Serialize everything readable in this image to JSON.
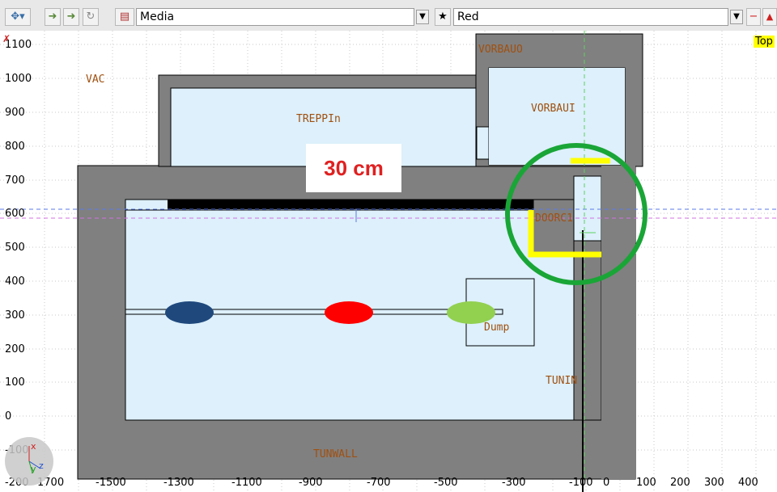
{
  "toolbar": {
    "media_select": "Media",
    "color_select": "Red",
    "view_label": "Top"
  },
  "annotation": {
    "thickness_label": "30 cm"
  },
  "regions": {
    "vac": "VAC",
    "treppin": "TREPPIn",
    "vorbauo": "VORBAUO",
    "vorbaui": "VORBAUI",
    "doorc1": "DOORC1",
    "dump": "Dump",
    "tunin": "TUNIN",
    "tunwall": "TUNWALL"
  },
  "axes": {
    "y_ticks": [
      "1100",
      "1000",
      "900",
      "800",
      "700",
      "600",
      "500",
      "400",
      "300",
      "200",
      "100",
      "0",
      "-100",
      "-200"
    ],
    "x_ticks": [
      "1700",
      "-1500",
      "-1300",
      "-1100",
      "-900",
      "-700",
      "-500",
      "-300",
      "-100",
      "0",
      "100",
      "200",
      "300",
      "400"
    ]
  },
  "beam_markers": {
    "colors": [
      "#1f497d",
      "#ff0000",
      "#92d050"
    ]
  },
  "highlight_colors": {
    "circle": "#1aa537",
    "bracket": "#ffff00"
  }
}
